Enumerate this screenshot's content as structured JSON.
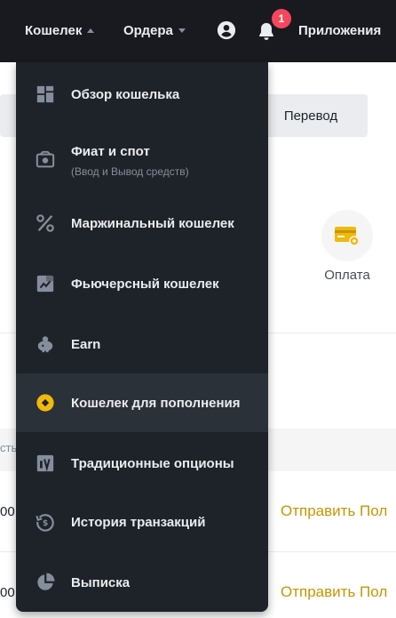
{
  "topbar": {
    "wallet_label": "Кошелек",
    "orders_label": "Ордера",
    "notifications_count": "1",
    "apps_label": "Приложения"
  },
  "background": {
    "transfer_label": "Перевод",
    "pay_label": "Оплата",
    "table_head_fragment": "сть",
    "row_values": [
      "00",
      "00"
    ],
    "row_action": "Отправить Пол"
  },
  "menu": {
    "items": [
      {
        "label": "Обзор кошелька",
        "icon": "dashboard-icon"
      },
      {
        "label": "Фиат и спот",
        "sub": "(Ввод и Вывод средств)",
        "icon": "fiat-spot-icon"
      },
      {
        "label": "Маржинальный кошелек",
        "icon": "percent-icon"
      },
      {
        "label": "Фьючерсный кошелек",
        "icon": "futures-icon"
      },
      {
        "label": "Earn",
        "icon": "piggy-bank-icon"
      },
      {
        "label": "Кошелек для пополнения",
        "icon": "funding-icon"
      },
      {
        "label": "Традиционные опционы",
        "icon": "options-icon"
      },
      {
        "label": "История транзакций",
        "icon": "history-icon"
      },
      {
        "label": "Выписка",
        "icon": "statement-icon"
      }
    ],
    "active_index": 5
  },
  "colors": {
    "topbar_bg": "#181a20",
    "menu_bg": "#1e2329",
    "menu_active_bg": "#2b3139",
    "accent": "#f0b90b",
    "link": "#c99400",
    "badge": "#f6465d"
  }
}
